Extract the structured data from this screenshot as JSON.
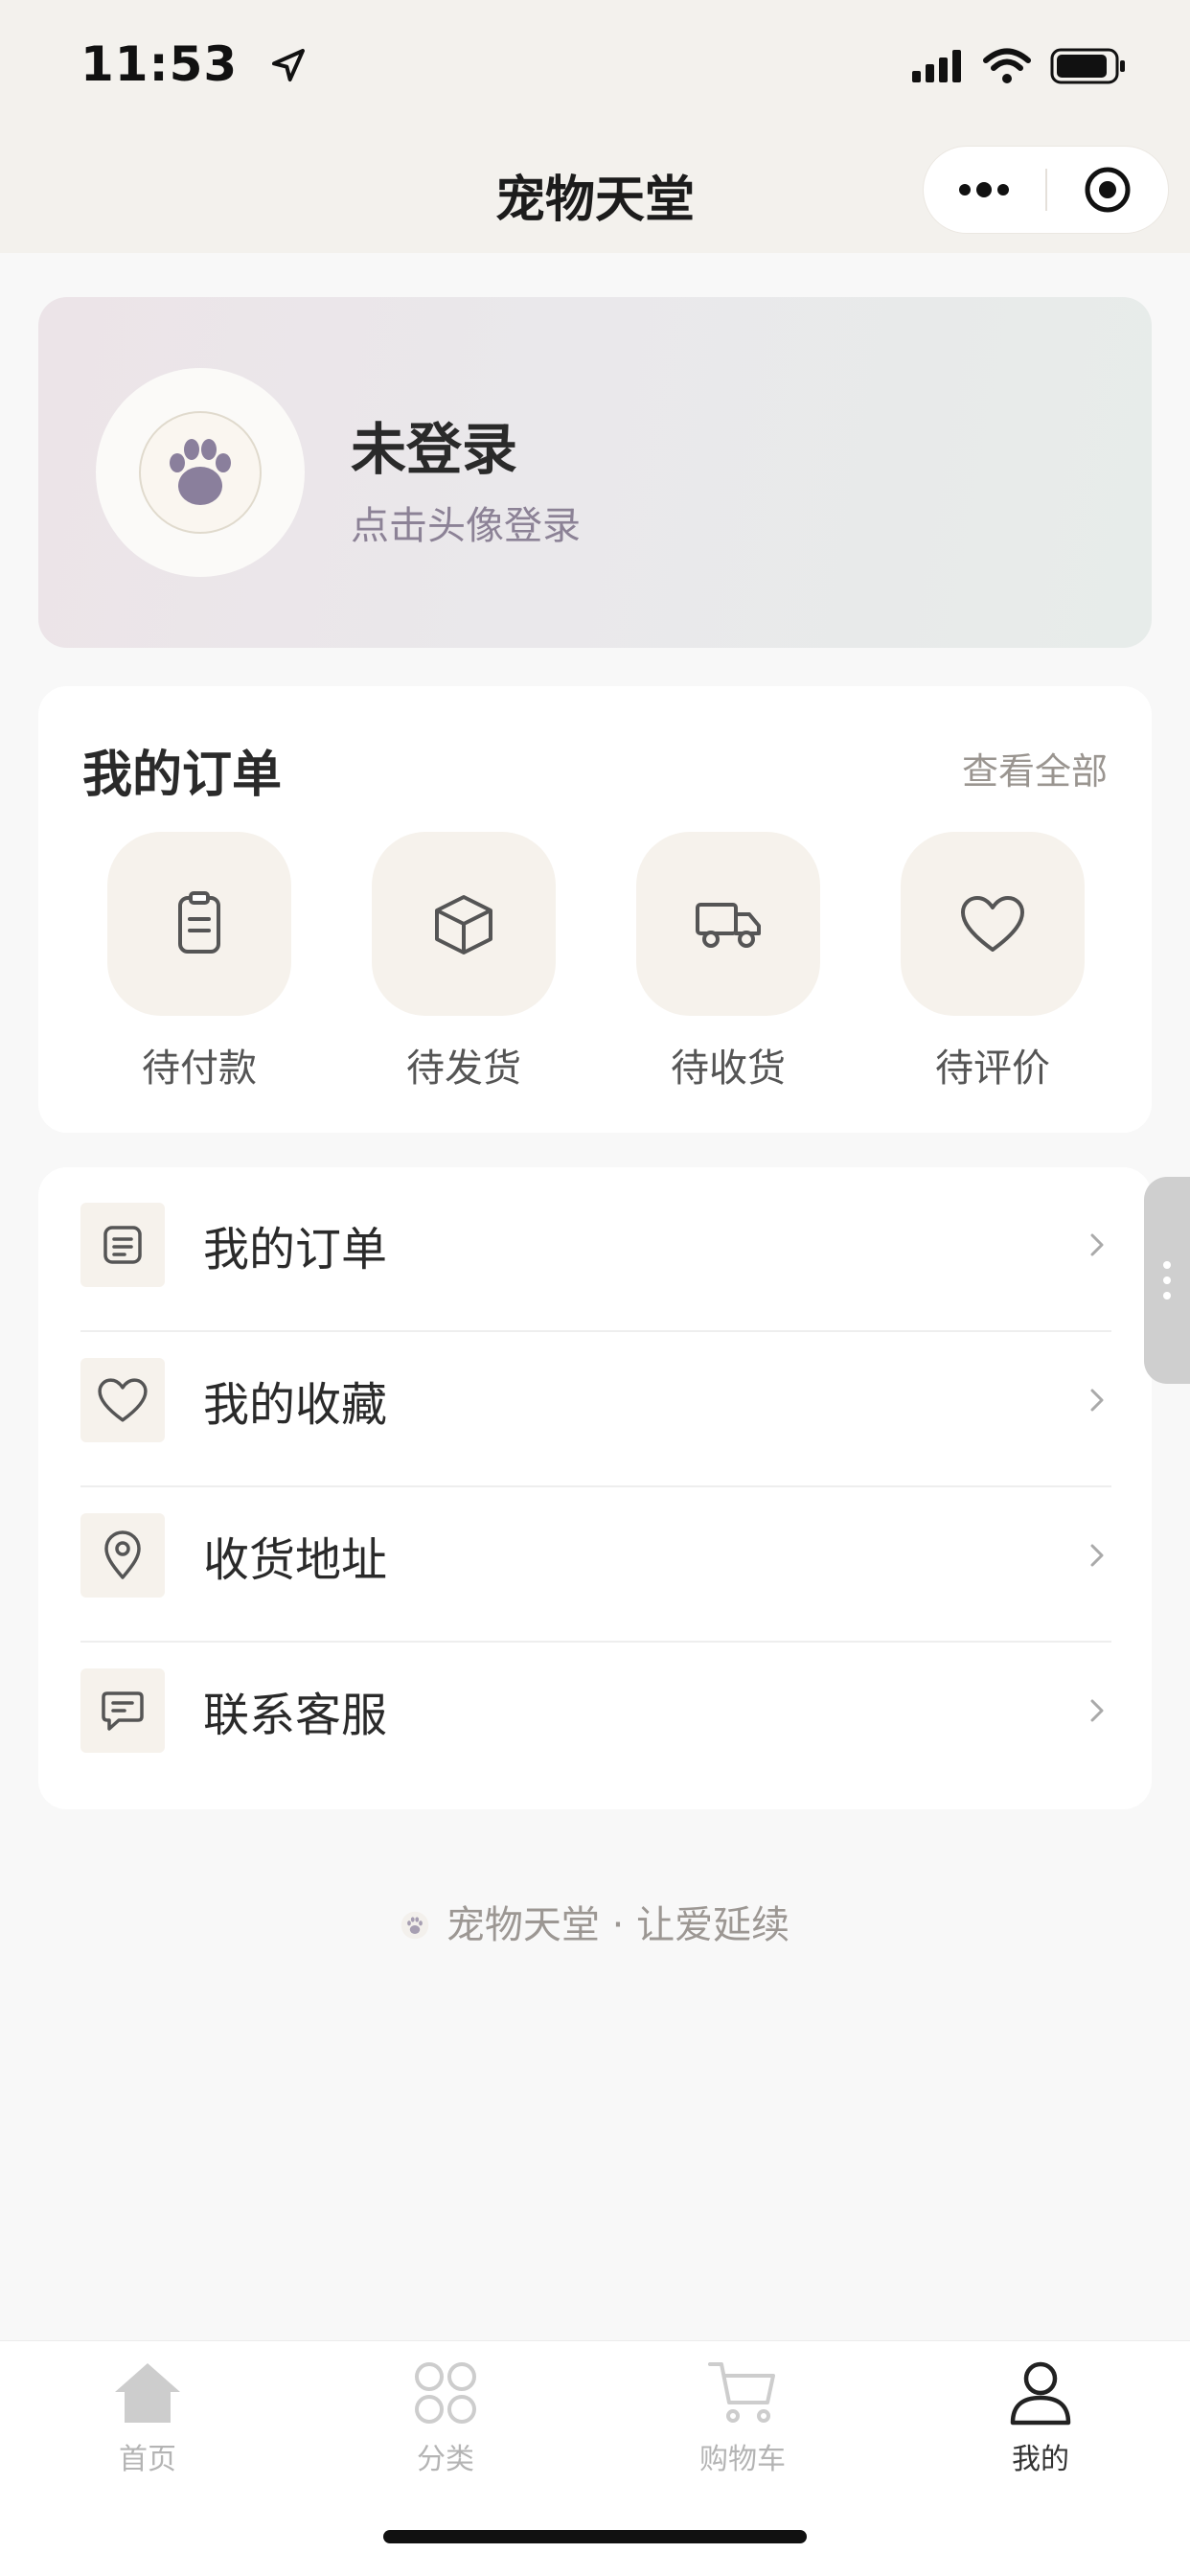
{
  "status_bar": {
    "time": "11:53"
  },
  "nav": {
    "title": "宠物天堂"
  },
  "profile": {
    "name": "未登录",
    "subtitle": "点击头像登录"
  },
  "orders": {
    "title": "我的订单",
    "view_all": "查看全部",
    "items": [
      {
        "label": "待付款",
        "icon": "clipboard-icon"
      },
      {
        "label": "待发货",
        "icon": "box-icon"
      },
      {
        "label": "待收货",
        "icon": "truck-icon"
      },
      {
        "label": "待评价",
        "icon": "heart-icon"
      }
    ]
  },
  "menu": {
    "items": [
      {
        "label": "我的订单",
        "icon": "document-icon"
      },
      {
        "label": "我的收藏",
        "icon": "heart-icon"
      },
      {
        "label": "收货地址",
        "icon": "location-pin-icon"
      },
      {
        "label": "联系客服",
        "icon": "chat-icon"
      }
    ]
  },
  "footer": {
    "text": "宠物天堂 · 让爱延续"
  },
  "tabbar": {
    "items": [
      {
        "label": "首页",
        "icon": "home-icon",
        "active": false
      },
      {
        "label": "分类",
        "icon": "category-icon",
        "active": false
      },
      {
        "label": "购物车",
        "icon": "cart-icon",
        "active": false
      },
      {
        "label": "我的",
        "icon": "person-icon",
        "active": true
      }
    ]
  },
  "colors": {
    "accent_purple": "#8a7f9c",
    "icon_bg": "#f6f2ec",
    "header_bg": "#f3f1ed",
    "text_dark": "#2a2a2a",
    "tab_inactive": "#b4b4b4"
  }
}
